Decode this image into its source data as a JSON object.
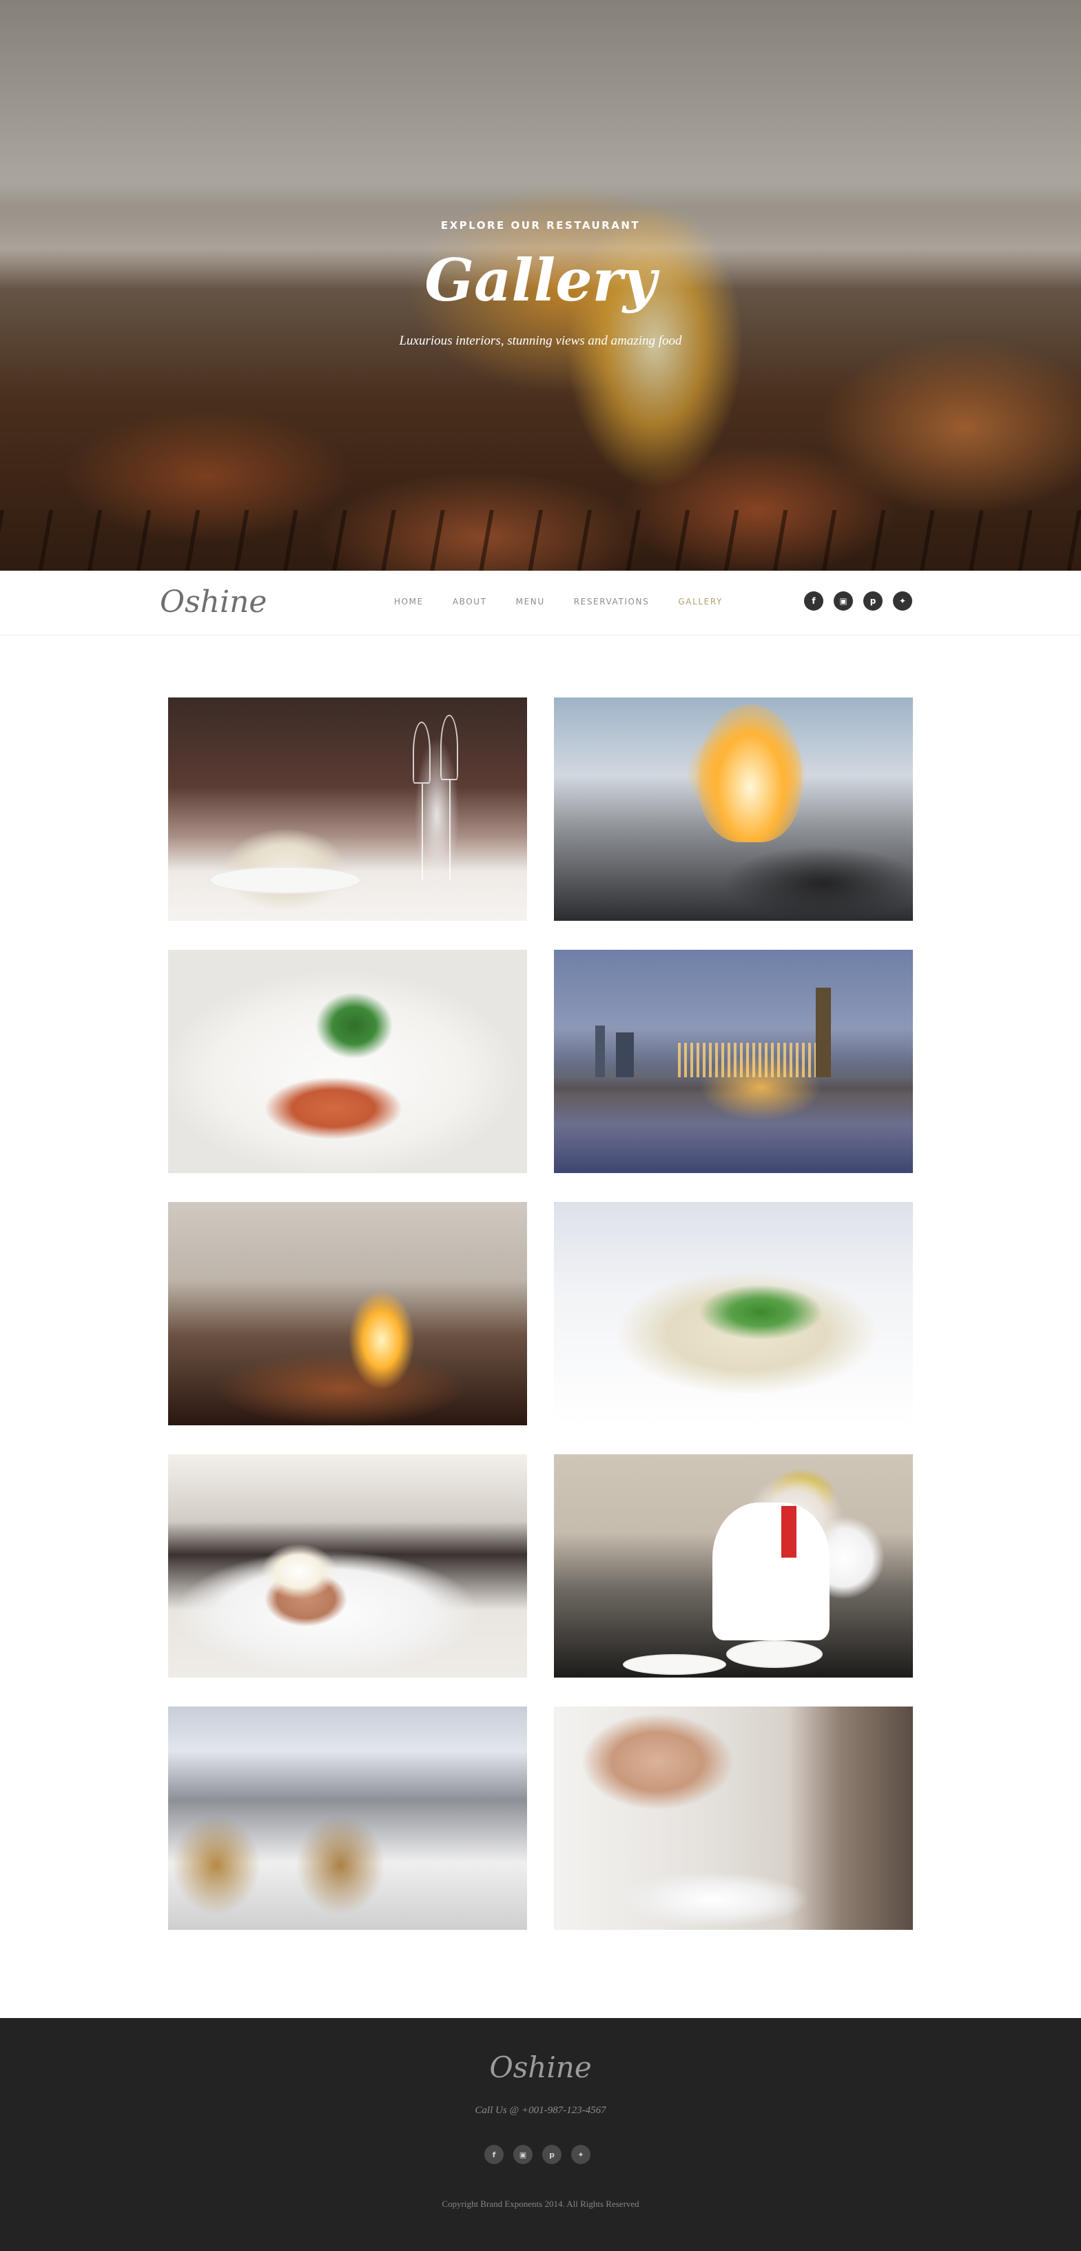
{
  "hero": {
    "eyebrow": "EXPLORE OUR RESTAURANT",
    "title": "Gallery",
    "subtitle": "Luxurious interiors, stunning views and amazing food"
  },
  "nav": {
    "logo": "Oshine",
    "menu": [
      {
        "label": "HOME",
        "active": false
      },
      {
        "label": "ABOUT",
        "active": false
      },
      {
        "label": "MENU",
        "active": false
      },
      {
        "label": "RESERVATIONS",
        "active": false
      },
      {
        "label": "GALLERY",
        "active": true
      }
    ],
    "social_icons": [
      "facebook-icon",
      "instagram-icon",
      "pinterest-icon",
      "twitter-icon"
    ],
    "active_color": "#b2a26a"
  },
  "gallery": {
    "items": [
      {
        "name": "table-setting-photo"
      },
      {
        "name": "flambe-pan-photo"
      },
      {
        "name": "salad-plate-photo"
      },
      {
        "name": "london-night-photo"
      },
      {
        "name": "grill-fire-photo"
      },
      {
        "name": "carpaccio-plate-photo"
      },
      {
        "name": "dessert-plate-photo"
      },
      {
        "name": "chef-cooking-photo"
      },
      {
        "name": "restaurant-tables-photo"
      },
      {
        "name": "chef-seasoning-photo"
      }
    ]
  },
  "footer": {
    "logo": "Oshine",
    "call": "Call Us @ +001-987-123-4567",
    "social_icons": [
      "facebook-icon",
      "instagram-icon",
      "pinterest-icon",
      "twitter-icon"
    ],
    "copyright": "Copyright Brand Exponents 2014. All Rights Reserved"
  },
  "colors": {
    "footer_bg": "#232323",
    "accent": "#b2a26a"
  }
}
